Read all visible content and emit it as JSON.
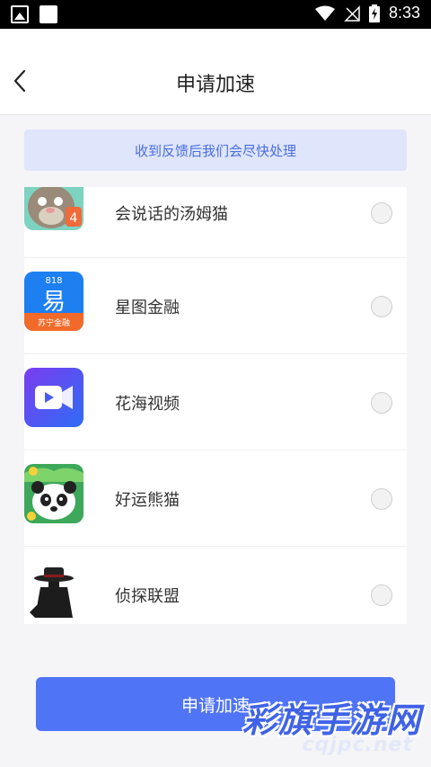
{
  "status_bar": {
    "time": "8:33",
    "icons": [
      "photo-icon",
      "square-icon",
      "wifi-icon",
      "no-signal-icon",
      "battery-charging-icon"
    ]
  },
  "header": {
    "title": "申请加速",
    "back_icon": "chevron-left-icon"
  },
  "notice": {
    "text": "收到反馈后我们会尽快处理"
  },
  "apps": [
    {
      "name": "会说话的汤姆猫",
      "icon": "tom-cat-icon",
      "selected": false
    },
    {
      "name": "星图金融",
      "icon": "star-finance-icon",
      "icon_badge": "818",
      "icon_text": "易",
      "icon_caption": "苏宁金融",
      "selected": false
    },
    {
      "name": "花海视频",
      "icon": "video-camera-icon",
      "selected": false
    },
    {
      "name": "好运熊猫",
      "icon": "panda-icon",
      "selected": false
    },
    {
      "name": "侦探联盟",
      "icon": "detective-icon",
      "selected": false
    }
  ],
  "submit_button": {
    "label": "申请加速"
  },
  "watermark": {
    "main": "彩旗手游网",
    "sub": "cqjpc.net"
  },
  "colors": {
    "accent": "#5074f6",
    "notice_bg": "#dfe5fb",
    "notice_text": "#4a6ee0"
  }
}
